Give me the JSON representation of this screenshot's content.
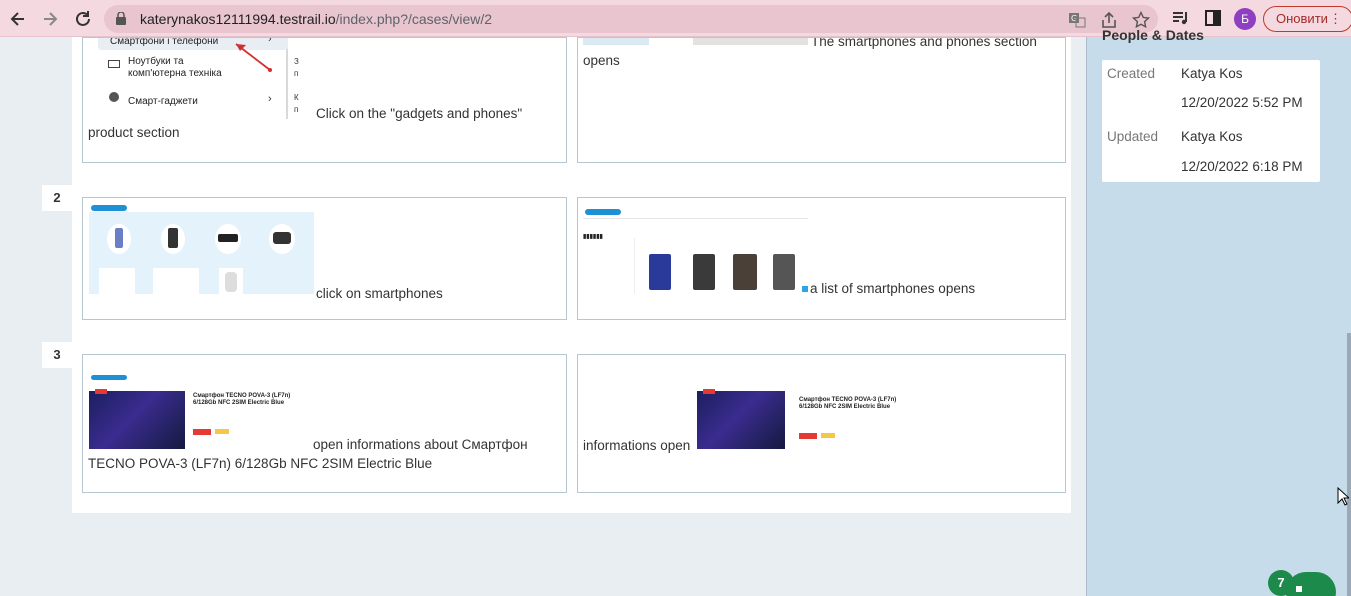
{
  "browser": {
    "url_host": "katerynakos12111994.testrail.io",
    "url_path": "/index.php?/cases/view/2",
    "avatar_letter": "Б",
    "update_label": "Оновити",
    "menu_dots": "⋮"
  },
  "steps": [
    {
      "number": "",
      "content_text": "Click on the \"gadgets and phones\" product section",
      "expected_text": "The smartphones and phones section opens",
      "menu_items": [
        "Смартфони i телефони",
        "Ноутбуки та комп'ютерна техніка",
        "Смарт-гаджети"
      ]
    },
    {
      "number": "2",
      "content_text": "click on smartphones",
      "expected_text": "a list of smartphones opens"
    },
    {
      "number": "3",
      "content_text": "open informations about Смартфон TECNO POVA-3 (LF7n) 6/128Gb NFC 2SIM Electric Blue",
      "expected_text": "informations open",
      "product_title": "Смартфон TECNO POVA-3 (LF7n) 6/128Gb NFC 2SIM Electric Blue"
    }
  ],
  "sidebar": {
    "heading": "People & Dates",
    "created_label": "Created",
    "created_by": "Katya Kos",
    "created_at": "12/20/2022 5:52 PM",
    "updated_label": "Updated",
    "updated_by": "Katya Kos",
    "updated_at": "12/20/2022 6:18 PM"
  },
  "chat": {
    "badge_count": "7"
  },
  "colors": {
    "browser_bar": "#f5d9e0",
    "sidebar_bg": "#c7dcea",
    "chat_green": "#1c8a4a",
    "accent_blue": "#1e90d6"
  }
}
